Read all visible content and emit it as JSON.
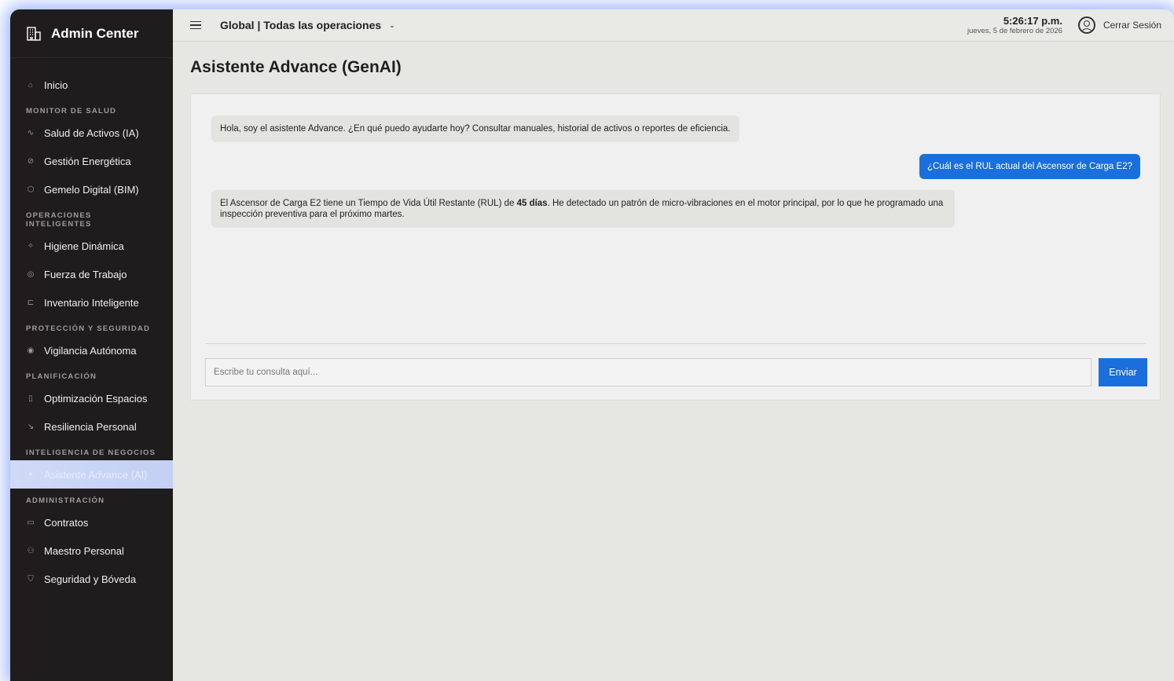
{
  "brand": {
    "title": "Admin Center",
    "icon": "building-icon"
  },
  "topbar": {
    "scope": "Global | Todas las operaciones",
    "time": "5:26:17 p.m.",
    "date": "jueves, 5 de febrero de 2026",
    "logout": "Cerrar Sesión"
  },
  "nav": {
    "home": "Inicio",
    "sec_health": "MONITOR DE SALUD",
    "assets": "Salud de Activos (IA)",
    "energy": "Gestión Energética",
    "twin": "Gemelo Digital (BIM)",
    "sec_ops": "OPERACIONES INTELIGENTES",
    "hygiene": "Higiene Dinámica",
    "workforce": "Fuerza de Trabajo",
    "inventory": "Inventario Inteligente",
    "sec_security": "PROTECCIÓN Y SEGURIDAD",
    "surveillance": "Vigilancia Autónoma",
    "sec_planning": "PLANIFICACIÓN",
    "spaces": "Optimización Espacios",
    "resilience": "Resiliencia Personal",
    "sec_bi": "INTELIGENCIA DE NEGOCIOS",
    "assistant": "Asistente Advance (AI)",
    "sec_admin": "ADMINISTRACIÓN",
    "contracts": "Contratos",
    "staff": "Maestro Personal",
    "vault": "Seguridad y Bóveda"
  },
  "page": {
    "title": "Asistente Advance (GenAI)"
  },
  "chat": {
    "bot_greeting": "Hola, soy el asistente Advance. ¿En qué puedo ayudarte hoy? Consultar manuales, historial de activos o reportes de eficiencia.",
    "user_question": "¿Cuál es el RUL actual del Ascensor de Carga E2?",
    "bot_answer_pre": "El Ascensor de Carga E2 tiene un Tiempo de Vida Útil Restante (RUL) de ",
    "bot_answer_bold": "45 días",
    "bot_answer_post": ". He detectado un patrón de micro-vibraciones en el motor principal, por lo que he programado una inspección preventiva para el próximo martes.",
    "input_placeholder": "Escribe tu consulta aquí...",
    "input_value": "",
    "send_label": "Enviar"
  },
  "colors": {
    "accent": "#1a6fdd",
    "sidebar_bg": "#1e1c1d",
    "active_item_bg": "#cfdaf7"
  }
}
